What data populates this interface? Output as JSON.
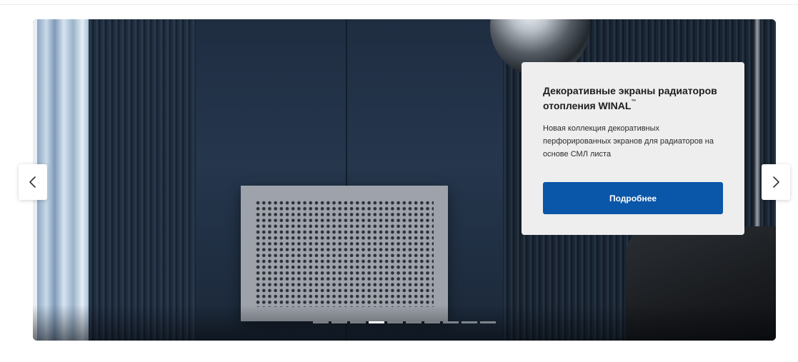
{
  "slider": {
    "slide": {
      "title": "Декоративные экраны радиаторов отопления WINAL",
      "title_mark": "™",
      "description": "Новая коллекция декоративных перфорированных экранов для радиаторов на основе СМЛ листа",
      "button_label": "Подробнее"
    },
    "pagination": {
      "total": 10,
      "active_index": 3
    },
    "prev_icon": "chevron-left-icon",
    "next_icon": "chevron-right-icon"
  },
  "colors": {
    "button": "#0a56a8",
    "card": "#eeeeee",
    "text": "#1d1d1f"
  }
}
